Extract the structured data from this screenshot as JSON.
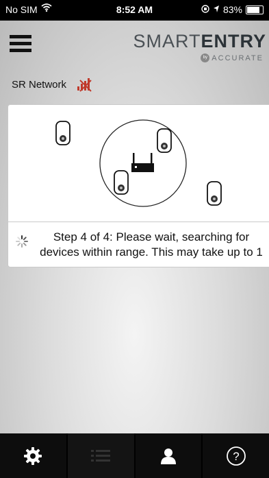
{
  "status_bar": {
    "carrier": "No SIM",
    "time": "8:52 AM",
    "battery": "83%",
    "battery_level": 0.83
  },
  "header": {
    "logo_main_light": "SMART",
    "logo_main_bold": "ENTRY",
    "logo_sub_by": "by",
    "logo_sub": "ACCURATE"
  },
  "network": {
    "label": "SR Network",
    "signal_state": "no-signal"
  },
  "step": {
    "line1": "Step 4 of 4: Please wait, searching for",
    "line2": "devices within range. This may take up to 1"
  },
  "tabs": [
    {
      "icon": "gear-icon",
      "active": false
    },
    {
      "icon": "list-icon",
      "active": true
    },
    {
      "icon": "user-icon",
      "active": false
    },
    {
      "icon": "help-icon",
      "active": false
    }
  ],
  "help_glyph": "?"
}
